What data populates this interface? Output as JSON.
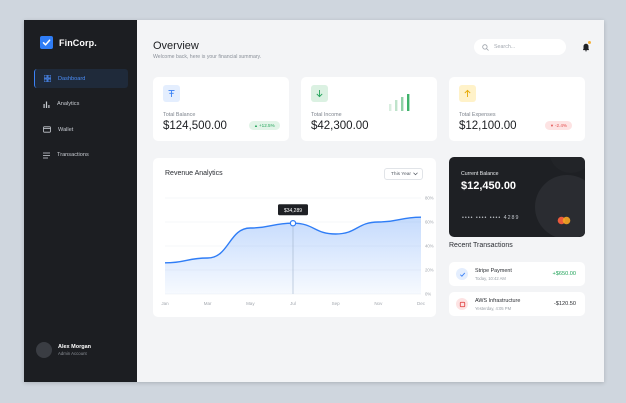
{
  "brand": {
    "name": "FinCorp."
  },
  "nav": [
    {
      "label": "Dashboard",
      "icon": "grid-icon",
      "active": true
    },
    {
      "label": "Analytics",
      "icon": "bar-chart-icon",
      "active": false
    },
    {
      "label": "Wallet",
      "icon": "wallet-icon",
      "active": false
    },
    {
      "label": "Transactions",
      "icon": "list-icon",
      "active": false
    }
  ],
  "user": {
    "name": "Alex Morgan",
    "role": "Admin Account"
  },
  "header": {
    "title": "Overview",
    "subtitle": "Welcome back, here is your financial summary.",
    "search_placeholder": "Search..."
  },
  "stats": [
    {
      "label": "Total Balance",
      "value": "$124,500.00",
      "badge": "+12.5%",
      "icon": "tether-icon",
      "color": "#3b82f6"
    },
    {
      "label": "Total Income",
      "value": "$42,300.00",
      "badge": "",
      "icon": "arrow-down-icon",
      "color": "#22a35a"
    },
    {
      "label": "Total Expenses",
      "value": "$12,100.00",
      "badge": "-2.4%",
      "icon": "arrow-up-icon",
      "color": "#e6a800"
    }
  ],
  "chart": {
    "title": "Revenue Analytics",
    "range": "This Year",
    "tooltip": "$34,289"
  },
  "chart_data": {
    "type": "area",
    "categories": [
      "Jan",
      "Mar",
      "May",
      "Jul",
      "Sep",
      "Nov",
      "Dec"
    ],
    "y_ticks": [
      "80%",
      "60%",
      "40%",
      "20%",
      "0%"
    ],
    "values": [
      26,
      30,
      55,
      59,
      50,
      60,
      64
    ],
    "ylim": [
      0,
      80
    ],
    "highlight_index": 3,
    "grid": true,
    "color": "#2f7df6"
  },
  "card": {
    "label": "Current Balance",
    "value": "$12,450.00",
    "number": "•••• •••• •••• 4289"
  },
  "transactions": {
    "title": "Recent Transactions",
    "items": [
      {
        "name": "Stripe Payment",
        "time": "Today, 10:42 AM",
        "amount": "+$650.00",
        "color": "#22a35a",
        "icon": "check-icon"
      },
      {
        "name": "AWS Infrastructure",
        "time": "Yesterday, 4:05 PM",
        "amount": "-$120.50",
        "color": "#2b2e33",
        "icon": "server-icon"
      }
    ]
  }
}
